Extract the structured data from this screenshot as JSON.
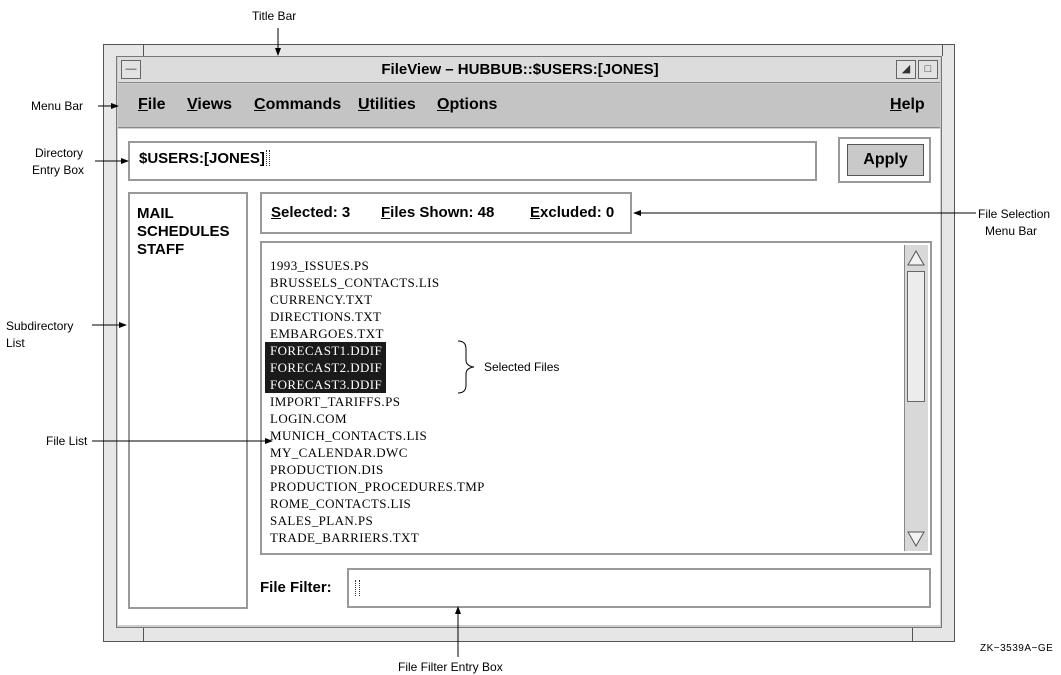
{
  "window": {
    "title": "FileView – HUBBUB::$USERS:[JONES]"
  },
  "menu": {
    "items": [
      "File",
      "Views",
      "Commands",
      "Utilities",
      "Options"
    ],
    "help": "Help"
  },
  "directory": {
    "value": "$USERS:[JONES]",
    "apply_label": "Apply"
  },
  "subdirectories": [
    "MAIL",
    "SCHEDULES",
    "STAFF"
  ],
  "selection": {
    "selected": "Selected: 3",
    "shown": "Files Shown: 48",
    "excluded": "Excluded: 0"
  },
  "files": [
    {
      "name": "1993_ISSUES.PS",
      "selected": false
    },
    {
      "name": "BRUSSELS_CONTACTS.LIS",
      "selected": false
    },
    {
      "name": "CURRENCY.TXT",
      "selected": false
    },
    {
      "name": "DIRECTIONS.TXT",
      "selected": false
    },
    {
      "name": "EMBARGOES.TXT",
      "selected": false
    },
    {
      "name": "FORECAST1.DDIF",
      "selected": true
    },
    {
      "name": "FORECAST2.DDIF",
      "selected": true
    },
    {
      "name": "FORECAST3.DDIF",
      "selected": true
    },
    {
      "name": "IMPORT_TARIFFS.PS",
      "selected": false
    },
    {
      "name": "LOGIN.COM",
      "selected": false
    },
    {
      "name": "MUNICH_CONTACTS.LIS",
      "selected": false
    },
    {
      "name": "MY_CALENDAR.DWC",
      "selected": false
    },
    {
      "name": "PRODUCTION.DIS",
      "selected": false
    },
    {
      "name": "PRODUCTION_PROCEDURES.TMP",
      "selected": false
    },
    {
      "name": "ROME_CONTACTS.LIS",
      "selected": false
    },
    {
      "name": "SALES_PLAN.PS",
      "selected": false
    },
    {
      "name": "TRADE_BARRIERS.TXT",
      "selected": false
    }
  ],
  "filter": {
    "label": "File Filter:",
    "value": ""
  },
  "annotations": {
    "title_bar": "Title Bar",
    "menu_bar": "Menu Bar",
    "directory_entry_box": [
      "Directory",
      "Entry Box"
    ],
    "file_selection_menu_bar": [
      "File Selection",
      "Menu Bar"
    ],
    "subdirectory_list": [
      "Subdirectory",
      "List"
    ],
    "selected_files": "Selected Files",
    "file_list": "File List",
    "file_filter_entry_box": "File Filter Entry Box",
    "figure_id": "ZK−3539A−GE"
  }
}
